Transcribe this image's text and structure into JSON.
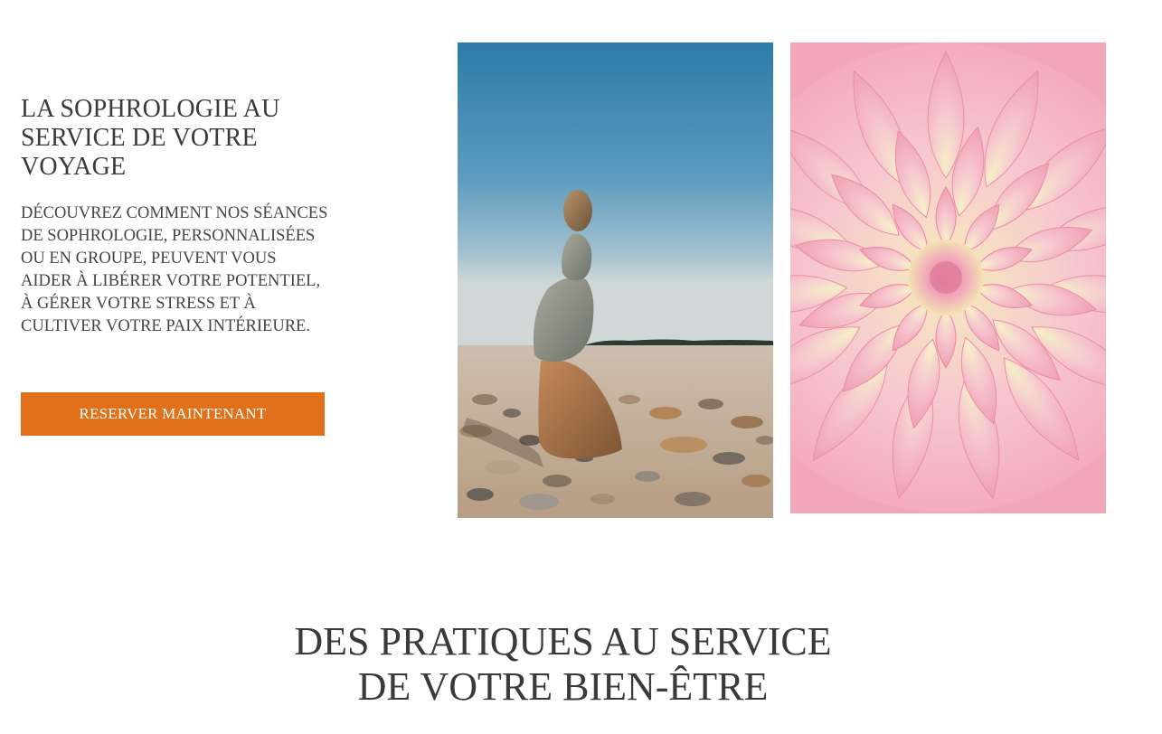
{
  "hero": {
    "title": "LA SOPHROLOGIE AU SERVICE DE VOTRE VOYAGE",
    "description": "DÉCOUVREZ COMMENT NOS SÉANCES DE SOPHROLOGIE, PERSONNALISÉES OU EN GROUPE, PEUVENT VOUS AIDER À LIBÉRER VOTRE POTENTIEL, À GÉRER VOTRE STRESS ET À CULTIVER VOTRE PAIX INTÉRIEURE.",
    "cta_label": "RESERVER MAINTENANT"
  },
  "gallery": [
    {
      "image": "stacked-stones-on-beach"
    },
    {
      "image": "pink-dahlia-flower"
    }
  ],
  "section": {
    "title_line1": "DES PRATIQUES AU SERVICE",
    "title_line2": "DE VOTRE BIEN-ÊTRE"
  },
  "colors": {
    "accent": "#e07019",
    "text": "#3a3a3a",
    "background": "#ffffff"
  }
}
